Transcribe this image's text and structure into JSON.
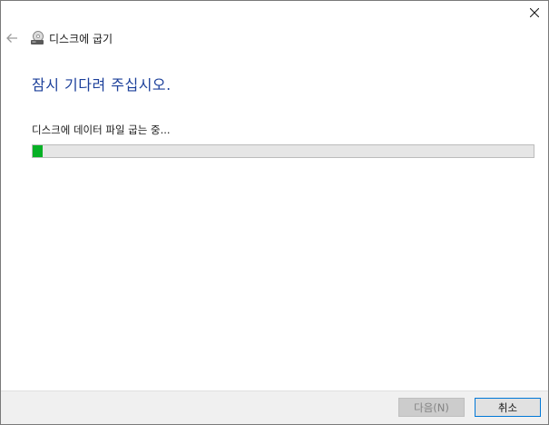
{
  "window": {
    "title": "디스크에 굽기"
  },
  "main": {
    "heading": "잠시 기다려 주십시오.",
    "status_text": "디스크에 데이터 파일 굽는 중...",
    "progress_fraction": 0.02
  },
  "footer": {
    "next_label": "다음(N)",
    "cancel_label": "취소"
  },
  "icons": {
    "back": "back-arrow-icon",
    "close": "close-icon",
    "disc": "disc-burner-icon"
  },
  "colors": {
    "heading": "#1b3f9a",
    "progress_fill": "#06b025",
    "cancel_border": "#0078d7"
  }
}
